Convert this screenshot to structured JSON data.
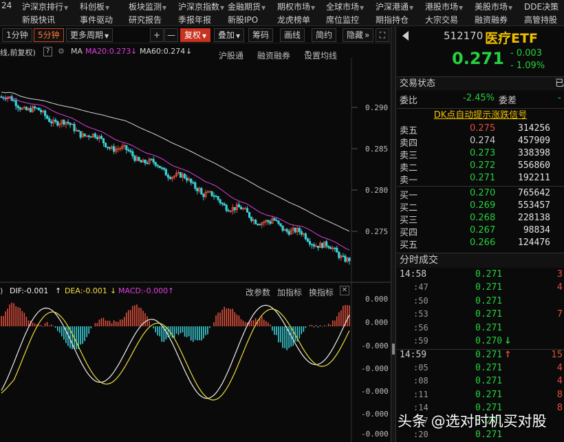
{
  "menu_row1": [
    "24",
    "沪深京排行",
    "科创板",
    "板块监测",
    "沪深京指数",
    "金融期货",
    "期权市场",
    "全球市场",
    "沪深港通",
    "港股市场",
    "美股市场",
    "DDE决策"
  ],
  "menu_row2": [
    "新股快讯",
    "事件驱动",
    "研究报告",
    "季报年报",
    "新股IPO",
    "龙虎榜单",
    "席位监控",
    "期指持仓",
    "大宗交易",
    "融资融券",
    "高管持股"
  ],
  "toolbar": {
    "min1": "1分钟",
    "min5": "5分钟",
    "more_period": "更多周期",
    "plus": "+",
    "minus": "—",
    "fuquan": "复权",
    "overlay": "叠加",
    "chips": "筹码",
    "draw": "画线",
    "brief": "简约",
    "hide": "隐藏",
    "more": "»"
  },
  "info": {
    "prefix": "线,前复权)",
    "q": "?",
    "ma": "MA",
    "ma20": "MA20:0.273",
    "ma60": "MA60:0.274",
    "link1": "沪股通",
    "link2": "融资融券",
    "link3": "设置均线"
  },
  "price_axis": [
    "0.290",
    "0.285",
    "0.280",
    "0.275"
  ],
  "macd": {
    "dif": "DIF:-0.001",
    "dea": "DEA:-0.001",
    "macd": "MACD:-0.000",
    "link1": "改参数",
    "link2": "加指标",
    "link3": "换指标"
  },
  "macd_axis": [
    "0.000",
    "0.000",
    "-0.000",
    "-0.000",
    "-0.000",
    "-0.000",
    "-0.000"
  ],
  "colors": {
    "up": "#e0503c",
    "down": "#26d13f",
    "ma20": "#e040e0",
    "ma60": "#dcdcdc",
    "dea": "#f0e040",
    "cyan": "#3ad0d8",
    "accent": "#f0c000"
  },
  "quote": {
    "code": "512170",
    "name": "医疗ETF",
    "price": "0.271",
    "change": "- 0.003",
    "pct": "- 1.09%"
  },
  "status": {
    "title": "交易状态",
    "ratio_label": "委比",
    "ratio": "-2.45%",
    "diff_label": "委差"
  },
  "signal": "DK点自动提示涨跌信号",
  "asks": [
    {
      "label": "卖五",
      "price": "0.275",
      "vol": "314256",
      "color": "#e0503c"
    },
    {
      "label": "卖四",
      "price": "0.274",
      "vol": "457909",
      "color": "#cfcfcf"
    },
    {
      "label": "卖三",
      "price": "0.273",
      "vol": "338398",
      "color": "#26d13f"
    },
    {
      "label": "卖二",
      "price": "0.272",
      "vol": "556860",
      "color": "#26d13f"
    },
    {
      "label": "卖一",
      "price": "0.271",
      "vol": "192211",
      "color": "#26d13f"
    }
  ],
  "bids": [
    {
      "label": "买一",
      "price": "0.270",
      "vol": "765642",
      "color": "#26d13f"
    },
    {
      "label": "买二",
      "price": "0.269",
      "vol": "553457",
      "color": "#26d13f"
    },
    {
      "label": "买三",
      "price": "0.268",
      "vol": "228138",
      "color": "#26d13f"
    },
    {
      "label": "买四",
      "price": "0.267",
      "vol": "98834",
      "color": "#26d13f"
    },
    {
      "label": "买五",
      "price": "0.266",
      "vol": "124476",
      "color": "#26d13f"
    }
  ],
  "trades_title": "分时成交",
  "trades": [
    {
      "time": "14:58",
      "sub": false,
      "price": "0.271",
      "vol": "3",
      "arrow": ""
    },
    {
      "time": ":47",
      "sub": true,
      "price": "0.271",
      "vol": "4",
      "arrow": ""
    },
    {
      "time": ":50",
      "sub": true,
      "price": "0.271",
      "vol": "",
      "arrow": ""
    },
    {
      "time": ":53",
      "sub": true,
      "price": "0.271",
      "vol": "7",
      "arrow": ""
    },
    {
      "time": ":56",
      "sub": true,
      "price": "0.271",
      "vol": "",
      "arrow": ""
    },
    {
      "time": ":59",
      "sub": true,
      "price": "0.270",
      "vol": "",
      "arrow": "down"
    },
    {
      "time": "14:59",
      "sub": false,
      "price": "0.271",
      "vol": "15",
      "arrow": "up"
    },
    {
      "time": ":05",
      "sub": true,
      "price": "0.271",
      "vol": "4",
      "arrow": ""
    },
    {
      "time": ":08",
      "sub": true,
      "price": "0.271",
      "vol": "4",
      "arrow": ""
    },
    {
      "time": ":11",
      "sub": true,
      "price": "0.271",
      "vol": "8",
      "arrow": ""
    },
    {
      "time": ":14",
      "sub": true,
      "price": "0.271",
      "vol": "8",
      "arrow": ""
    },
    {
      "time": ":17",
      "sub": true,
      "price": "0.271",
      "vol": "",
      "arrow": ""
    },
    {
      "time": ":20",
      "sub": true,
      "price": "0.271",
      "vol": "",
      "arrow": ""
    }
  ],
  "watermark": "头条 @选对时机买对股"
}
